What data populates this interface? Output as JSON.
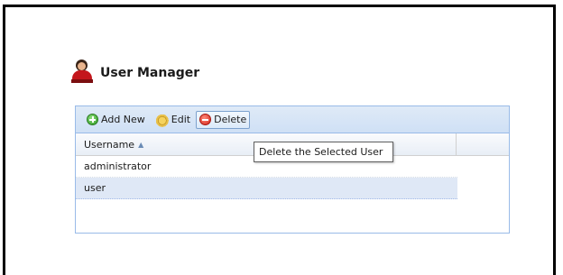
{
  "header": {
    "title": "User Manager",
    "icon": "user-icon"
  },
  "toolbar": {
    "add_label": "Add New",
    "edit_label": "Edit",
    "delete_label": "Delete"
  },
  "grid": {
    "columns": [
      {
        "label": "Username",
        "sort": "ascending"
      }
    ],
    "rows": [
      {
        "username": "administrator",
        "selected": false
      },
      {
        "username": "user",
        "selected": true
      }
    ]
  },
  "tooltip": {
    "text": "Delete the Selected User"
  }
}
